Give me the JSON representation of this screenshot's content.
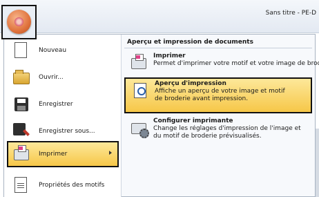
{
  "window": {
    "title": "Sans titre - PE-D"
  },
  "left_menu": {
    "items": [
      {
        "label": "Nouveau",
        "icon": "new-document-icon"
      },
      {
        "label": "Ouvrir...",
        "icon": "open-folder-icon"
      },
      {
        "label": "Enregistrer",
        "icon": "save-icon"
      },
      {
        "label": "Enregistrer sous...",
        "icon": "save-as-icon"
      },
      {
        "label": "Imprimer",
        "icon": "print-icon"
      },
      {
        "label": "Propriétés des motifs",
        "icon": "properties-icon"
      }
    ],
    "active_index": 4
  },
  "submenu": {
    "header": "Aperçu et impression de documents",
    "items": [
      {
        "title": "Imprimer",
        "description": "Permet d'imprimer votre motif et votre image de broderie.",
        "icon": "print-icon"
      },
      {
        "title": "Aperçu d'impression",
        "description": "Affiche un aperçu de votre image et motif de broderie avant impression.",
        "icon": "print-preview-icon"
      },
      {
        "title": "Configurer imprimante",
        "description": "Change les réglages d'impression de l'image et du motif de broderie prévisualisés.",
        "icon": "printer-settings-icon"
      }
    ],
    "highlighted_index": 1
  },
  "colors": {
    "highlight": "#f6c748",
    "frame": "#111111",
    "menu_bg": "#f7f9fc"
  }
}
